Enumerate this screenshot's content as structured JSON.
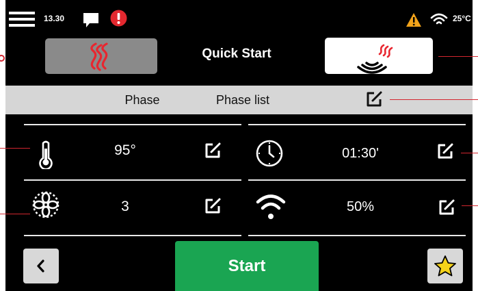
{
  "status_bar": {
    "time": "13.30",
    "temperature": "25°C",
    "icons": [
      "menu-icon",
      "chat-icon",
      "alert-icon",
      "warning-icon",
      "wifi-icon"
    ],
    "colors": {
      "alert": "#e3282f",
      "warning": "#f2a31a"
    }
  },
  "header": {
    "title": "Quick Start",
    "left_mode_icon": "heat-waves-icon",
    "right_mode_icon": "microwave-heat-icon"
  },
  "tabs": {
    "phase": "Phase",
    "phase_list": "Phase list"
  },
  "settings": {
    "temperature": {
      "icon": "thermometer-icon",
      "value": "95°"
    },
    "time": {
      "icon": "clock-icon",
      "value": "01:30'"
    },
    "fan": {
      "icon": "fan-icon",
      "value": "3"
    },
    "microwave_power": {
      "icon": "microwave-power-icon",
      "value": "50%"
    }
  },
  "footer": {
    "back_icon": "chevron-left-icon",
    "start_label": "Start",
    "favorite_icon": "star-icon",
    "colors": {
      "start": "#1aa552",
      "star": "#f4d21a"
    }
  }
}
